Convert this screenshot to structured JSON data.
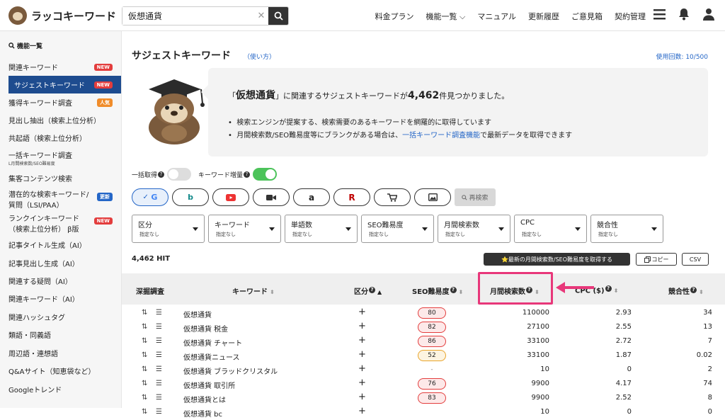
{
  "header": {
    "logo": "ラッコキーワード",
    "search_value": "仮想通貨",
    "nav": [
      "料金プラン",
      "機能一覧 ⌵",
      "マニュアル",
      "更新履歴",
      "ご意見箱",
      "契約管理"
    ]
  },
  "sidebar": {
    "heading": "機能一覧",
    "items": [
      {
        "label": "関連キーワード",
        "badge": "NEW"
      },
      {
        "label": "サジェストキーワード",
        "badge": "NEW"
      },
      {
        "label": "獲得キーワード調査",
        "badge": "人気"
      },
      {
        "label": "見出し抽出（検索上位分析）"
      },
      {
        "label": "共起語（検索上位分析）"
      },
      {
        "label": "一括キーワード調査",
        "sub": "L月間検索数/SEO難易度"
      },
      {
        "label": "集客コンテンツ検索"
      },
      {
        "label": "潜在的な検索キーワード/",
        "label2": "質問（LSI/PAA）",
        "badge": "更新"
      },
      {
        "label": "ランクインキーワード",
        "label2": "（検索上位分析） β版",
        "badge": "NEW"
      },
      {
        "label": "記事タイトル生成（AI）"
      },
      {
        "label": "記事見出し生成（AI）"
      },
      {
        "label": "関連する疑問（AI）"
      },
      {
        "label": "関連キーワード（AI）"
      },
      {
        "label": "関連ハッシュタグ"
      },
      {
        "label": "類語・同義語"
      },
      {
        "label": "周辺語・連想語"
      },
      {
        "label": "Q&Aサイト（知恵袋など）"
      },
      {
        "label": "Googleトレンド"
      }
    ]
  },
  "main": {
    "title": "サジェストキーワード",
    "howto": "（使い方）",
    "usage": "使用回数: 10/500",
    "info_pre": "「",
    "info_keyword": "仮想通貨",
    "info_mid": "」に関連するサジェストキーワードが",
    "info_count": "4,462",
    "info_post": "件見つかりました。",
    "bullet1": "検索エンジンが提案する、検索需要のあるキーワードを網羅的に取得しています",
    "bullet2_pre": "月間検索数/SEO難易度等にブランクがある場合は、",
    "bullet2_link": "一括キーワード調査機能",
    "bullet2_post": "で最新データを取得できます",
    "toggle1": "一括取得",
    "toggle2": "キーワード増量",
    "reload": "再検索",
    "filters": [
      {
        "title": "区分",
        "sub": "指定なし"
      },
      {
        "title": "キーワード",
        "sub": "指定なし"
      },
      {
        "title": "単語数",
        "sub": "指定なし"
      },
      {
        "title": "SEO難易度",
        "sub": "指定なし"
      },
      {
        "title": "月間検索数",
        "sub": "指定なし"
      },
      {
        "title": "CPC",
        "sub": "指定なし"
      },
      {
        "title": "競合性",
        "sub": "指定なし"
      }
    ],
    "hit": "4,462 HIT",
    "btn_latest": "⭐最新の月間検索数/SEO難易度を取得する",
    "btn_copy": "コピー",
    "btn_csv": "CSV"
  },
  "table": {
    "headers": [
      "深掘調査",
      "キーワード",
      "区分",
      "SEO難易度",
      "月間検索数",
      "CPC ($)",
      "競合性"
    ],
    "rows": [
      {
        "kw": "仮想通貨",
        "seo": "80",
        "seo_level": "red",
        "vol": "110000",
        "cpc": "2.93",
        "comp": "34"
      },
      {
        "kw": "仮想通貨 税金",
        "seo": "82",
        "seo_level": "red",
        "vol": "27100",
        "cpc": "2.55",
        "comp": "13"
      },
      {
        "kw": "仮想通貨 チャート",
        "seo": "86",
        "seo_level": "red",
        "vol": "33100",
        "cpc": "2.72",
        "comp": "7"
      },
      {
        "kw": "仮想通貨ニュース",
        "seo": "52",
        "seo_level": "yel",
        "vol": "33100",
        "cpc": "1.87",
        "comp": "0.02"
      },
      {
        "kw": "仮想通貨 ブラッドクリスタル",
        "seo": "-",
        "seo_level": "none",
        "vol": "10",
        "cpc": "0",
        "comp": "2"
      },
      {
        "kw": "仮想通貨 取引所",
        "seo": "76",
        "seo_level": "red",
        "vol": "9900",
        "cpc": "4.17",
        "comp": "74"
      },
      {
        "kw": "仮想通貨とは",
        "seo": "83",
        "seo_level": "red",
        "vol": "9900",
        "cpc": "2.52",
        "comp": "8"
      },
      {
        "kw": "仮想通貨 bc",
        "seo": "",
        "seo_level": "none",
        "vol": "10",
        "cpc": "0",
        "comp": "0"
      }
    ]
  },
  "colors": {
    "accent": "#1e4c8f",
    "highlight": "#e8377a",
    "new_badge": "#e33d3d",
    "popular_badge": "#f08c2a",
    "update_badge": "#2466c7"
  }
}
